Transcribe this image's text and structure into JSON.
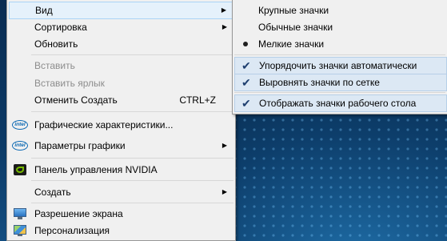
{
  "context_menu": {
    "items": [
      {
        "label": "Вид",
        "has_submenu": true,
        "icon": ""
      },
      {
        "label": "Сортировка",
        "has_submenu": true,
        "icon": ""
      },
      {
        "label": "Обновить",
        "icon": ""
      },
      {
        "label": "Вставить",
        "disabled": true,
        "icon": ""
      },
      {
        "label": "Вставить ярлык",
        "disabled": true,
        "icon": ""
      },
      {
        "label": "Отменить Создать",
        "shortcut": "CTRL+Z",
        "icon": ""
      },
      {
        "label": "Графические характеристики...",
        "icon": "intel-icon"
      },
      {
        "label": "Параметры графики",
        "has_submenu": true,
        "icon": "intel-icon"
      },
      {
        "label": "Панель управления NVIDIA",
        "icon": "nvidia-icon"
      },
      {
        "label": "Создать",
        "has_submenu": true,
        "icon": ""
      },
      {
        "label": "Разрешение экрана",
        "icon": "display-icon"
      },
      {
        "label": "Персонализация",
        "icon": "personalization-icon"
      }
    ],
    "intel_text": "intel",
    "submenu_arrow": "▶"
  },
  "view_submenu": {
    "items": [
      {
        "label": "Крупные значки",
        "state": "none"
      },
      {
        "label": "Обычные значки",
        "state": "none"
      },
      {
        "label": "Мелкие значки",
        "state": "bullet"
      },
      {
        "label": "Упорядочить значки автоматически",
        "state": "checked"
      },
      {
        "label": "Выровнять значки по сетке",
        "state": "checked"
      },
      {
        "label": "Отображать значки рабочего стола",
        "state": "checked"
      }
    ],
    "check_glyph": "✔"
  },
  "colors": {
    "menu_background": "#f0f0f0",
    "hover_highlight": "#e5f1fb",
    "checked_highlight": "#dce8f4",
    "disabled_text": "#8d8d8d",
    "desktop_background": "#0d3e6b"
  }
}
